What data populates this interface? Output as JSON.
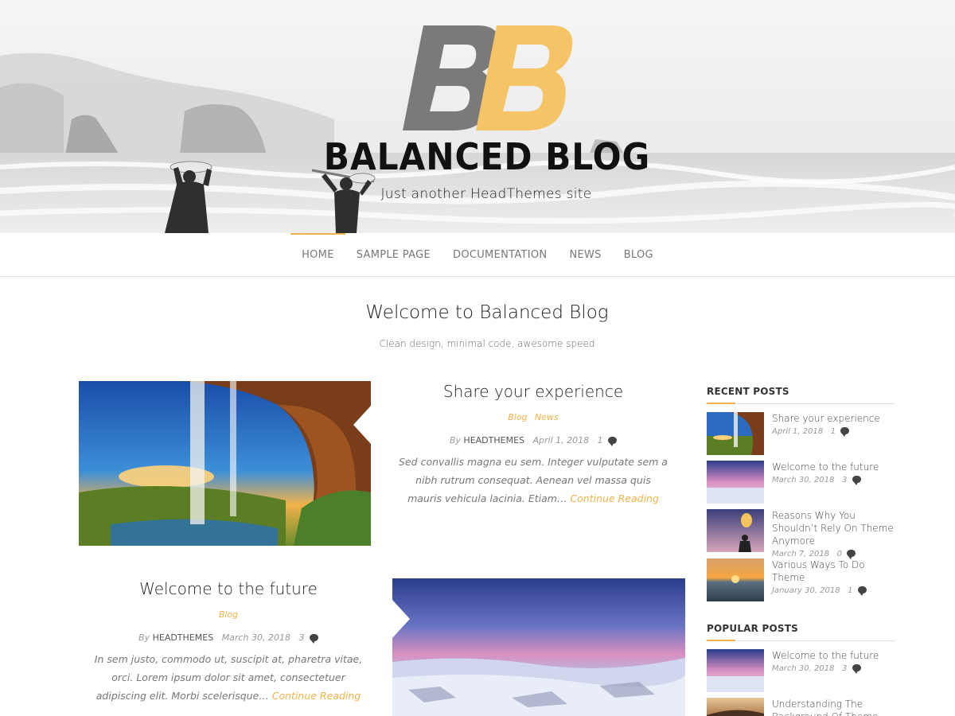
{
  "header": {
    "site_title": "BALANCED BLOG",
    "tagline": "Just another HeadThemes site",
    "logo_letters": "BB",
    "logo_colors": {
      "first": "#7a7a7a",
      "second": "#f5c466"
    }
  },
  "nav": {
    "items": [
      {
        "label": "HOME",
        "active": true
      },
      {
        "label": "SAMPLE PAGE"
      },
      {
        "label": "DOCUMENTATION"
      },
      {
        "label": "NEWS"
      },
      {
        "label": "BLOG"
      }
    ]
  },
  "intro": {
    "title": "Welcome to Balanced Blog",
    "subtitle": "Clean design, minimal code, awesome speed"
  },
  "posts": [
    {
      "title": "Share your experience",
      "categories": [
        "Blog",
        "News"
      ],
      "by": "By",
      "author": "HEADTHEMES",
      "date": "April 1, 2018",
      "comments": "1",
      "excerpt": "Sed convallis magna eu sem. Integer vulputate sem a nibh rutrum consequat. Aenean vel massa quis mauris vehicula lacinia. Etiam…",
      "more": "Continue Reading",
      "image": "waterfall"
    },
    {
      "title": "Welcome to the future",
      "categories": [
        "Blog"
      ],
      "by": "By",
      "author": "HEADTHEMES",
      "date": "March 30, 2018",
      "comments": "3",
      "excerpt": "In sem justo, commodo ut, suscipit at, pharetra vitae, orci. Lorem ipsum dolor sit amet, consectetuer adipiscing elit. Morbi scelerisque…",
      "more": "Continue Reading",
      "image": "snow-landscape"
    }
  ],
  "sidebar": {
    "recent": {
      "title": "RECENT POSTS",
      "items": [
        {
          "title": "Share your experience",
          "date": "April 1, 2018",
          "comments": "1"
        },
        {
          "title": "Welcome to the future",
          "date": "March 30, 2018",
          "comments": "3"
        },
        {
          "title": "Reasons Why You Shouldn’t Rely On Theme Anymore",
          "date": "March 7, 2018",
          "comments": "0"
        },
        {
          "title": "Various Ways To Do Theme",
          "date": "January 30, 2018",
          "comments": "1"
        }
      ]
    },
    "popular": {
      "title": "POPULAR POSTS",
      "items": [
        {
          "title": "Welcome to the future",
          "date": "March 30, 2018",
          "comments": "3"
        },
        {
          "title": "Understanding The Background Of Theme"
        }
      ]
    }
  },
  "colors": {
    "accent": "#f0b34b"
  },
  "icons": {
    "comments": "comment-bubble-icon"
  }
}
